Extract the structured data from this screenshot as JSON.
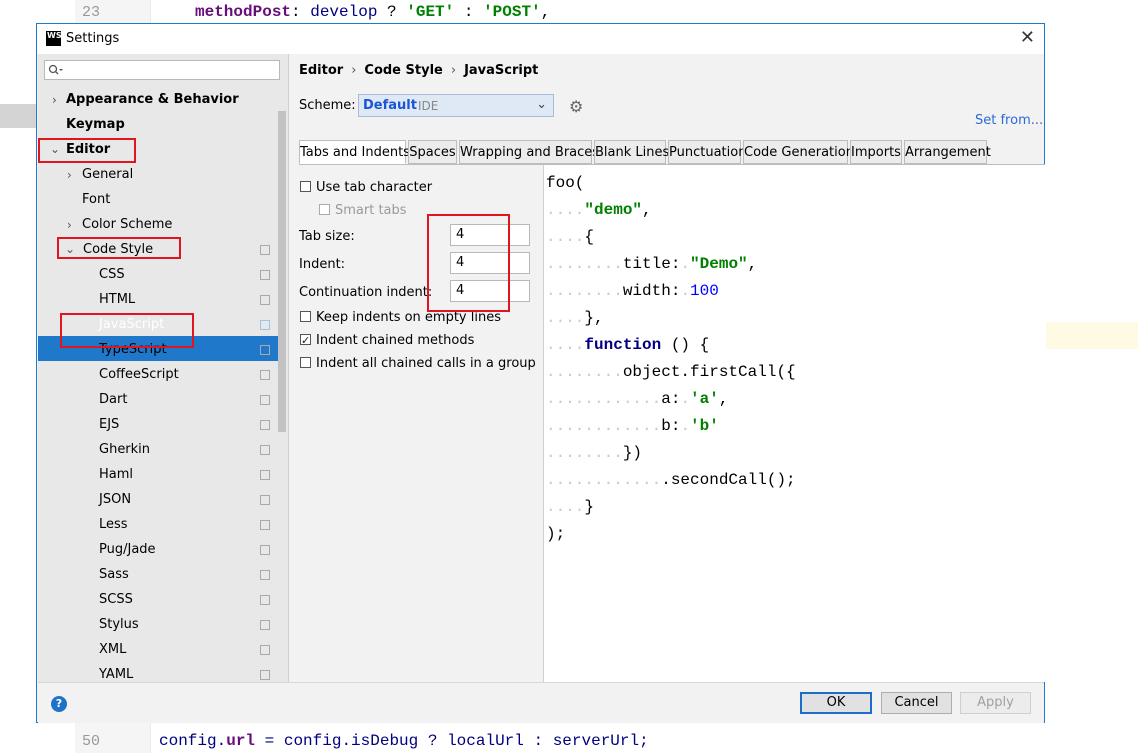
{
  "background_editor": {
    "top_line_number": "23",
    "top_line": {
      "prop": "methodPost",
      "colon": ": ",
      "var": "develop",
      "q": " ? ",
      "s1": "'GET'",
      "mid": " : ",
      "s2": "'POST'",
      "end": ","
    },
    "bottom_line_number": "50",
    "bottom_line": {
      "a": "config.",
      "b": "url",
      "c": " = config.",
      "d": "isDebug",
      "e": " ? localUrl : serverUrl;"
    }
  },
  "window": {
    "title": "Settings",
    "logo": "WS",
    "close_icon": "close-icon"
  },
  "search": {
    "placeholder": "",
    "icon": "search-icon"
  },
  "tree": {
    "appearance": "Appearance & Behavior",
    "keymap": "Keymap",
    "editor": "Editor",
    "general": "General",
    "font": "Font",
    "color_scheme": "Color Scheme",
    "code_style": "Code Style",
    "languages": [
      "CSS",
      "HTML",
      "JavaScript",
      "TypeScript",
      "CoffeeScript",
      "Dart",
      "EJS",
      "Gherkin",
      "Haml",
      "JSON",
      "Less",
      "Pug/Jade",
      "Sass",
      "SCSS",
      "Stylus",
      "XML",
      "YAML"
    ],
    "selected": "JavaScript"
  },
  "breadcrumb": {
    "items": [
      "Editor",
      "Code Style",
      "JavaScript"
    ],
    "separator": "›"
  },
  "scheme": {
    "label": "Scheme:",
    "value": "Default",
    "sub": "IDE",
    "set_from": "Set from..."
  },
  "tabs": [
    "Tabs and Indents",
    "Spaces",
    "Wrapping and Braces",
    "Blank Lines",
    "Punctuation",
    "Code Generation",
    "Imports",
    "Arrangement"
  ],
  "options": {
    "use_tab": "Use tab character",
    "smart_tabs": "Smart tabs",
    "tab_size_label": "Tab size:",
    "tab_size": "4",
    "indent_label": "Indent:",
    "indent": "4",
    "cont_indent_label": "Continuation indent:",
    "cont_indent": "4",
    "keep_indents": "Keep indents on empty lines",
    "indent_chained": "Indent chained methods",
    "indent_all_chained": "Indent all chained calls in a group",
    "use_tab_checked": false,
    "smart_tabs_checked": false,
    "keep_indents_checked": false,
    "indent_chained_checked": true,
    "indent_all_chained_checked": false
  },
  "preview": {
    "l1": "foo(",
    "l2_str": "\"demo\"",
    "l3": "{",
    "l4_key": "title",
    "l4_val": "\"Demo\"",
    "l5_key": "width",
    "l5_val": "100",
    "l6": "},",
    "l7_kw": "function",
    "l7_rest": " () {",
    "l8": "object.firstCall({",
    "l9_key": "a",
    "l9_val": "'a'",
    "l10_key": "b",
    "l10_val": "'b'",
    "l11": "})",
    "l12": ".secondCall();",
    "l13": "}",
    "l14": ");"
  },
  "buttons": {
    "ok": "OK",
    "cancel": "Cancel",
    "apply": "Apply",
    "help": "?"
  },
  "colors": {
    "accent": "#1f78c9",
    "annotation": "#e0161e"
  }
}
